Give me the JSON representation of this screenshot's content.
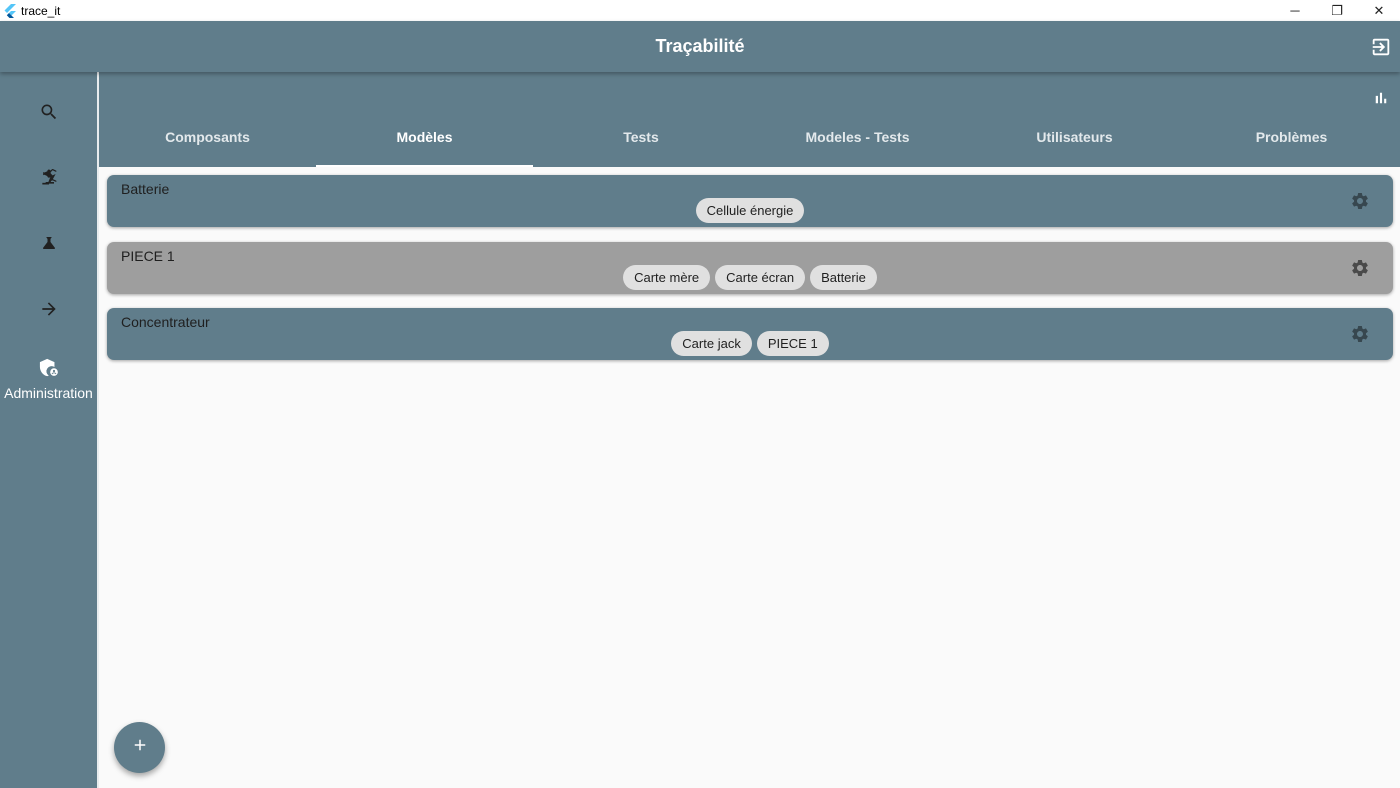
{
  "window": {
    "app_name": "trace_it",
    "minimize": "─",
    "restore": "❐",
    "close": "✕"
  },
  "appbar": {
    "title": "Traçabilité",
    "logout_icon": "logout-icon"
  },
  "sidebar": {
    "items": [
      {
        "icon": "search-icon",
        "label": ""
      },
      {
        "icon": "precision-manufacturing-icon",
        "label": ""
      },
      {
        "icon": "flask-icon",
        "label": ""
      },
      {
        "icon": "arrow-forward-icon",
        "label": ""
      },
      {
        "icon": "admin-shield-icon",
        "label": "Administration"
      }
    ]
  },
  "tabs": [
    {
      "label": "Composants",
      "active": false
    },
    {
      "label": "Modèles",
      "active": true
    },
    {
      "label": "Tests",
      "active": false
    },
    {
      "label": "Modeles - Tests",
      "active": false
    },
    {
      "label": "Utilisateurs",
      "active": false
    },
    {
      "label": "Problèmes",
      "active": false
    }
  ],
  "models": [
    {
      "name": "Batterie",
      "color": "#607d8b",
      "components": [
        "Cellule énergie"
      ]
    },
    {
      "name": "PIECE 1",
      "color": "#9e9e9e",
      "components": [
        "Carte mère",
        "Carte écran",
        "Batterie"
      ]
    },
    {
      "name": "Concentrateur",
      "color": "#607d8b",
      "components": [
        "Carte jack",
        "PIECE 1"
      ]
    }
  ],
  "fab": {
    "icon": "add-icon"
  },
  "colors": {
    "primary": "#607d8b",
    "disabled_card": "#9e9e9e",
    "chip": "#e0e0e0",
    "background": "#fafafa"
  }
}
